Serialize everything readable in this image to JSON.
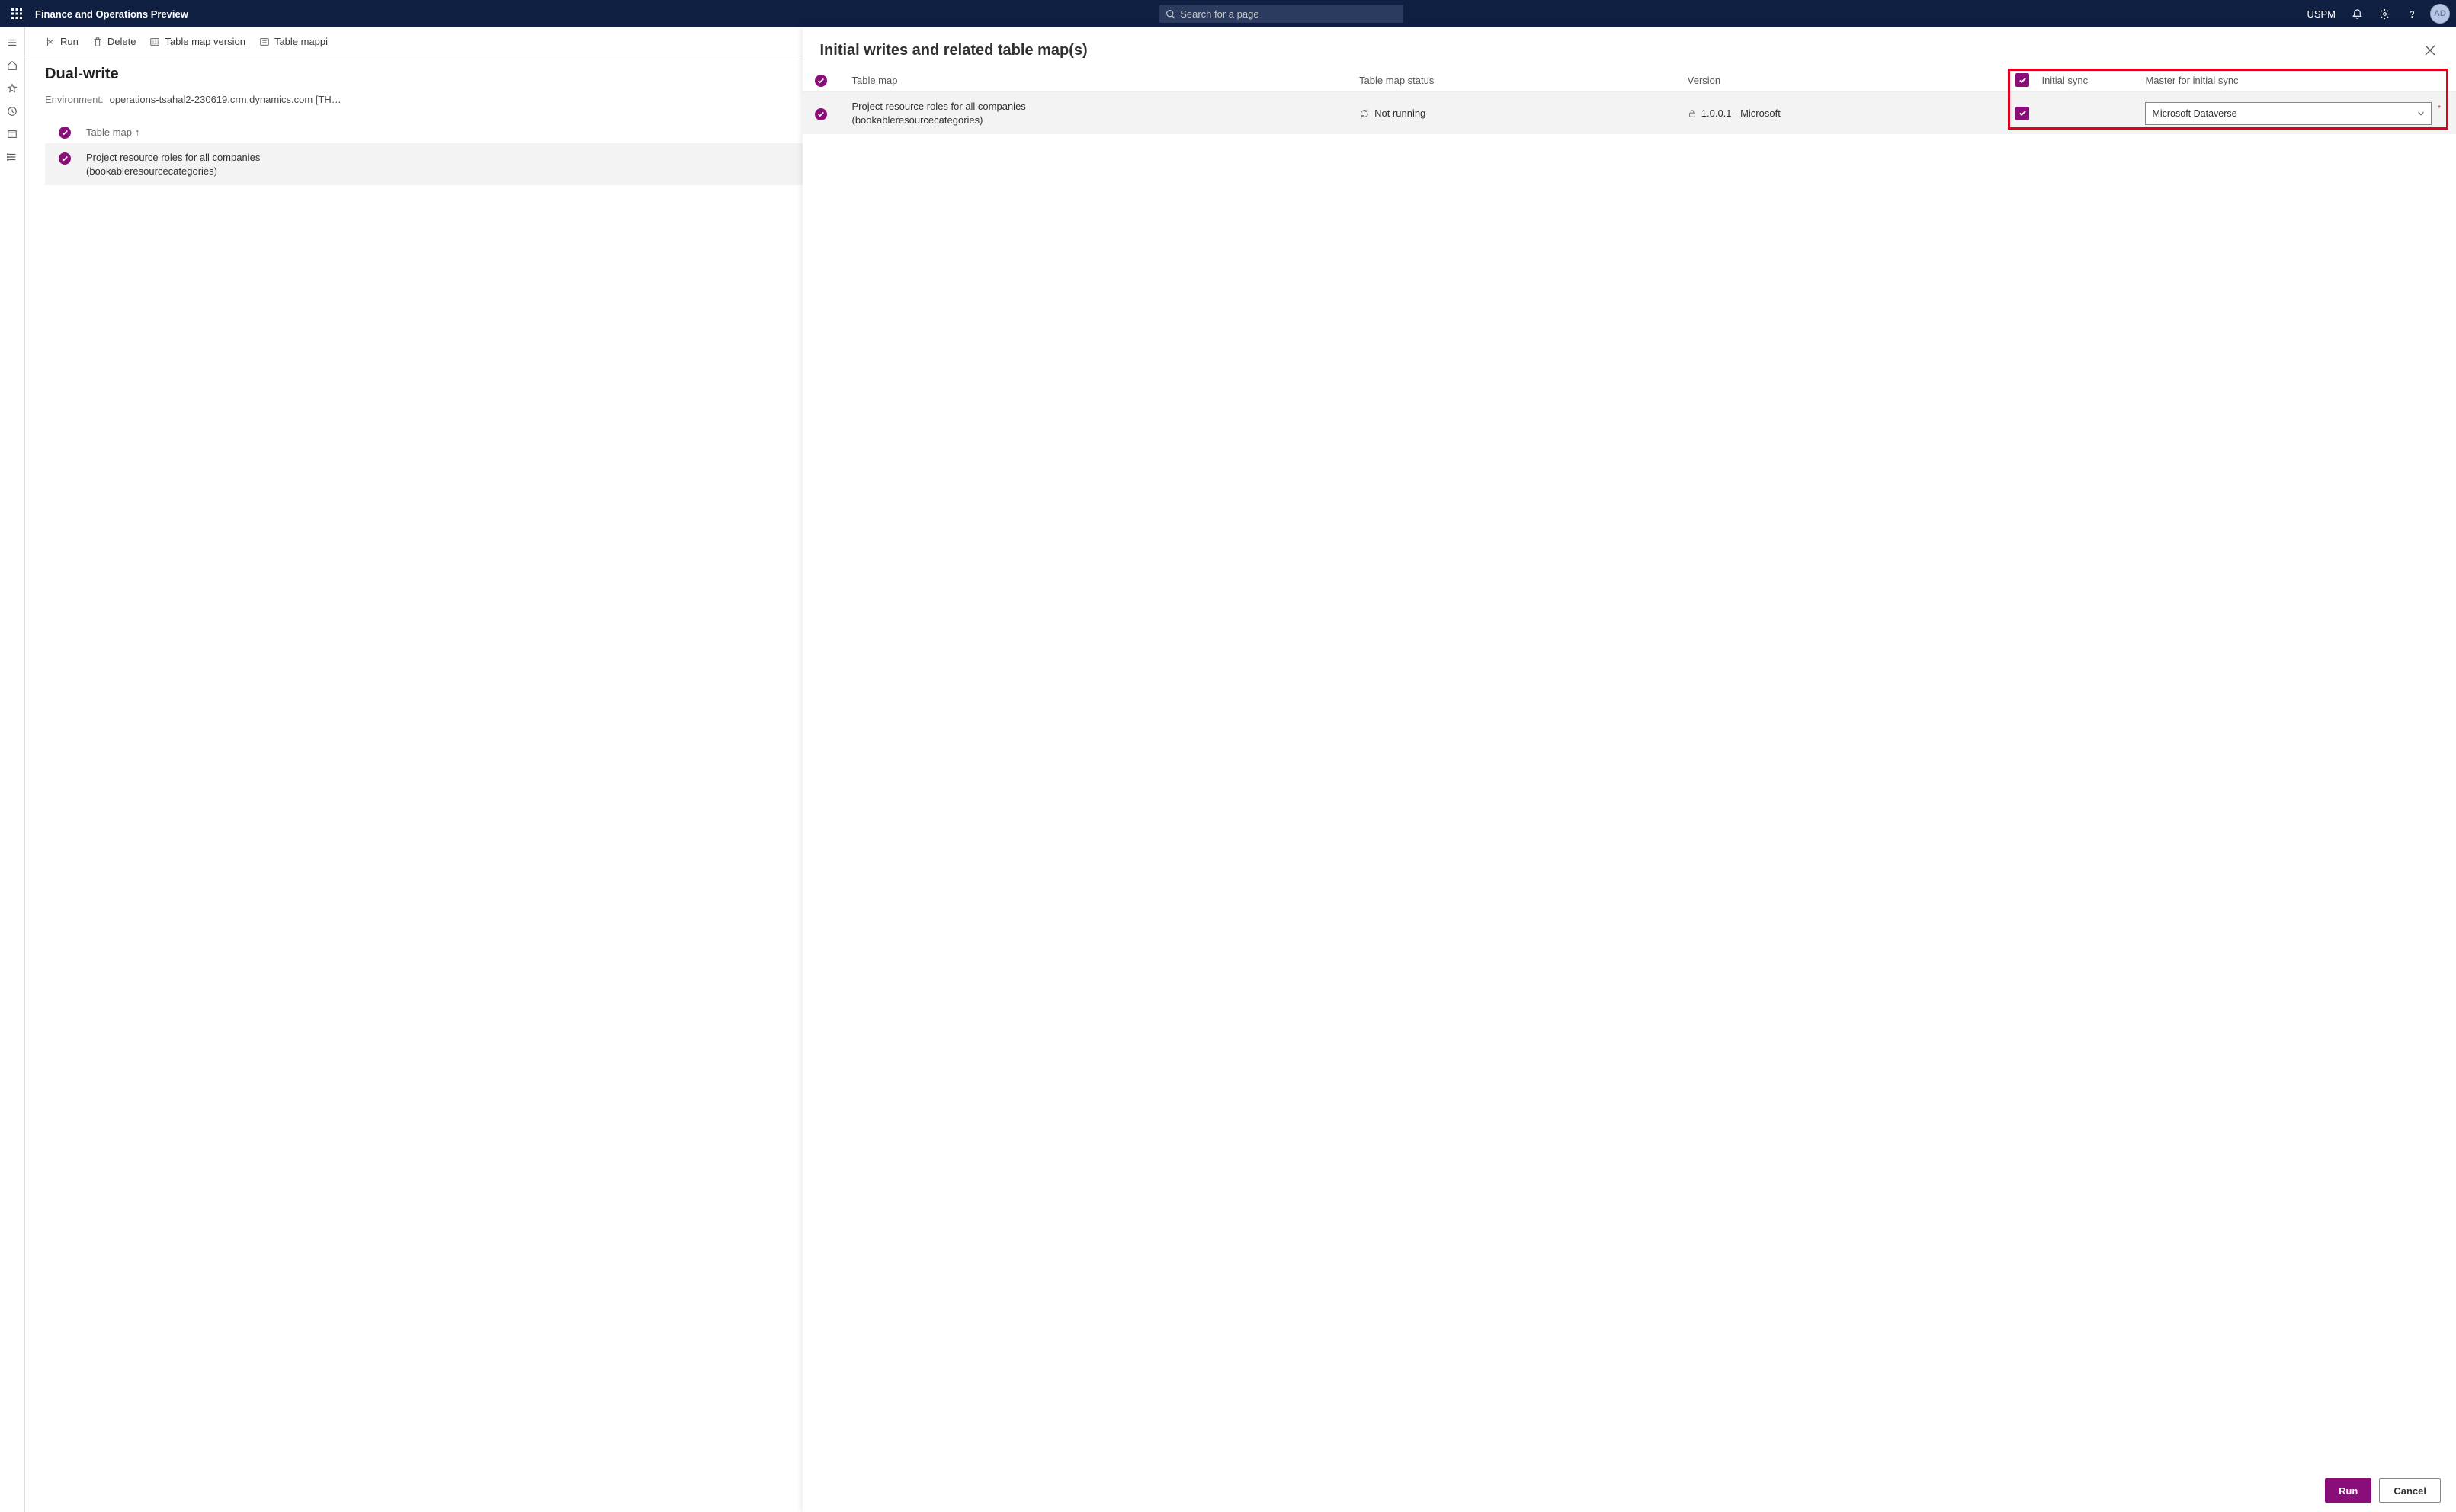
{
  "suite": {
    "app_title": "Finance and Operations Preview",
    "search_placeholder": "Search for a page",
    "company_code": "USPM",
    "avatar_initials": "AD"
  },
  "action_bar": {
    "run": "Run",
    "delete": "Delete",
    "table_map_version": "Table map version",
    "table_mappings": "Table mappi"
  },
  "page": {
    "title": "Dual-write",
    "env_label": "Environment:",
    "env_value": "operations-tsahal2-230619.crm.dynamics.com [THPM..."
  },
  "list": {
    "header_col": "Table map",
    "row1_line1": "Project resource roles for all companies",
    "row1_line2": "(bookableresourcecategories)"
  },
  "panel": {
    "title": "Initial writes and related table map(s)",
    "cols": {
      "table_map": "Table map",
      "status": "Table map status",
      "version": "Version",
      "initial_sync": "Initial sync",
      "master": "Master for initial sync"
    },
    "row": {
      "name_line1": "Project resource roles for all companies",
      "name_line2": "(bookableresourcecategories)",
      "status": "Not running",
      "version": "1.0.0.1 - Microsoft",
      "master_value": "Microsoft Dataverse"
    },
    "buttons": {
      "run": "Run",
      "cancel": "Cancel"
    }
  }
}
